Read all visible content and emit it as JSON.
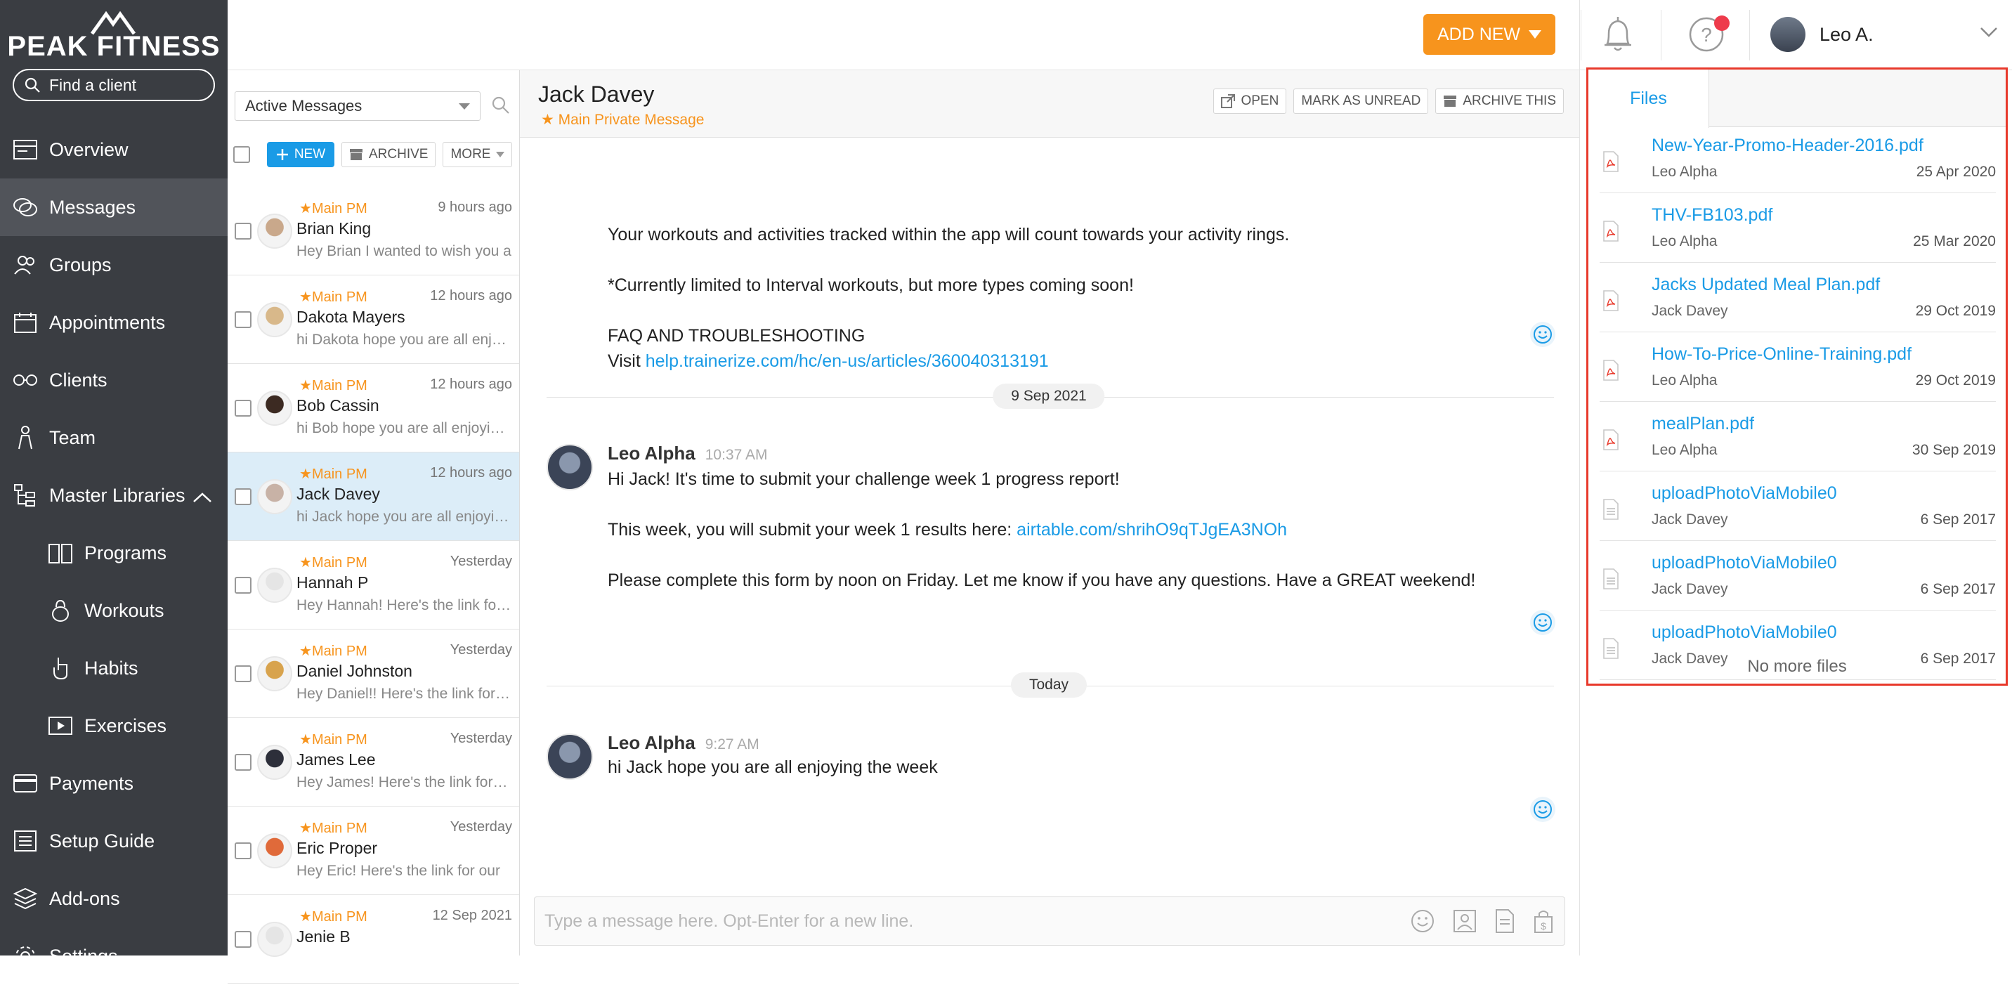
{
  "brand": {
    "name": "PEAK FITNESS"
  },
  "sidebar": {
    "search_label": "Find a client",
    "items": [
      {
        "label": "Overview",
        "icon": "overview-icon"
      },
      {
        "label": "Messages",
        "icon": "messages-icon",
        "active": true
      },
      {
        "label": "Groups",
        "icon": "groups-icon"
      },
      {
        "label": "Appointments",
        "icon": "calendar-icon"
      },
      {
        "label": "Clients",
        "icon": "clients-icon"
      },
      {
        "label": "Team",
        "icon": "team-icon"
      },
      {
        "label": "Master Libraries",
        "icon": "libraries-icon",
        "expanded": true
      },
      {
        "label": "Programs",
        "icon": "programs-icon",
        "sub": true
      },
      {
        "label": "Workouts",
        "icon": "kettlebell-icon",
        "sub": true
      },
      {
        "label": "Habits",
        "icon": "habits-icon",
        "sub": true
      },
      {
        "label": "Exercises",
        "icon": "video-icon",
        "sub": true
      },
      {
        "label": "Payments",
        "icon": "payments-icon"
      },
      {
        "label": "Setup Guide",
        "icon": "setup-guide-icon"
      },
      {
        "label": "Add-ons",
        "icon": "addons-icon"
      },
      {
        "label": "Settings",
        "icon": "settings-icon"
      }
    ]
  },
  "header": {
    "add_new_label": "ADD NEW",
    "user_name": "Leo A."
  },
  "conversations": {
    "filter_value": "Active Messages",
    "new_label": "NEW",
    "archive_label": "ARCHIVE",
    "more_label": "MORE",
    "items": [
      {
        "tag": "Main PM",
        "time": "9 hours ago",
        "name": "Brian King",
        "preview": "Hey Brian I wanted to wish you a",
        "avatar_color": "#c9a88b"
      },
      {
        "tag": "Main PM",
        "time": "12 hours ago",
        "name": "Dakota Mayers",
        "preview": "hi Dakota hope you are all enjoying the week",
        "avatar_color": "#d8b88a"
      },
      {
        "tag": "Main PM",
        "time": "12 hours ago",
        "name": "Bob Cassin",
        "preview": "hi Bob hope you are all enjoying the week",
        "avatar_color": "#3c2a22"
      },
      {
        "tag": "Main PM",
        "time": "12 hours ago",
        "name": "Jack Davey",
        "preview": "hi Jack hope you are all enjoying the week",
        "avatar_color": "#c8b2a6",
        "selected": true
      },
      {
        "tag": "Main PM",
        "time": "Yesterday",
        "name": "Hannah P",
        "preview": "Hey Hannah! Here's the link for our",
        "avatar_color": "#e5e5e5"
      },
      {
        "tag": "Main PM",
        "time": "Yesterday",
        "name": "Daniel Johnston",
        "preview": "Hey Daniel!! Here's the link for our",
        "avatar_color": "#d8a34d"
      },
      {
        "tag": "Main PM",
        "time": "Yesterday",
        "name": "James Lee",
        "preview": "Hey James! Here's the link for our",
        "avatar_color": "#2d2f3a"
      },
      {
        "tag": "Main PM",
        "time": "Yesterday",
        "name": "Eric Proper",
        "preview": "Hey Eric! Here's the link for our",
        "avatar_color": "#e06a3a"
      },
      {
        "tag": "Main PM",
        "time": "12 Sep 2021",
        "name": "Jenie B",
        "preview": "",
        "avatar_color": "#e5e5e5"
      }
    ]
  },
  "chat": {
    "contact_name": "Jack Davey",
    "thread_label": "Main Private Message",
    "open_label": "OPEN",
    "mark_unread_label": "MARK AS UNREAD",
    "archive_label": "ARCHIVE THIS",
    "top_lines": {
      "line1": "Your workouts and activities tracked within the app will count towards your activity rings.",
      "line2": "*Currently limited to Interval workouts, but more types coming soon!",
      "line3": "FAQ AND TROUBLESHOOTING",
      "visit_prefix": "Visit ",
      "visit_link": "help.trainerize.com/hc/en-us/articles/360040313191"
    },
    "date1": "9 Sep 2021",
    "msg1": {
      "sender": "Leo Alpha",
      "time": "10:37 AM",
      "line1": "Hi Jack! It's time to submit your challenge week 1 progress report!",
      "line2_prefix": "This week, you will submit your week 1 results here: ",
      "line2_link": "airtable.com/shrihO9qTJgEA3NOh",
      "line3": "Please complete this form by noon on Friday. Let me know if you have any questions. Have a GREAT weekend!"
    },
    "date2": "Today",
    "msg2": {
      "sender": "Leo Alpha",
      "time": "9:27 AM",
      "line1": "hi Jack hope you are all enjoying the week"
    },
    "composer_placeholder": "Type a message here. Opt-Enter for a new line."
  },
  "files": {
    "tab_label": "Files",
    "items": [
      {
        "name": "New-Year-Promo-Header-2016.pdf",
        "owner": "Leo Alpha",
        "date": "25 Apr 2020",
        "type": "pdf"
      },
      {
        "name": "THV-FB103.pdf",
        "owner": "Leo Alpha",
        "date": "25 Mar 2020",
        "type": "pdf"
      },
      {
        "name": "Jacks Updated Meal Plan.pdf",
        "owner": "Jack Davey",
        "date": "29 Oct 2019",
        "type": "pdf"
      },
      {
        "name": "How-To-Price-Online-Training.pdf",
        "owner": "Leo Alpha",
        "date": "29 Oct 2019",
        "type": "pdf"
      },
      {
        "name": "mealPlan.pdf",
        "owner": "Leo Alpha",
        "date": "30 Sep 2019",
        "type": "pdf"
      },
      {
        "name": "uploadPhotoViaMobile0",
        "owner": "Jack Davey",
        "date": "6 Sep 2017",
        "type": "doc"
      },
      {
        "name": "uploadPhotoViaMobile0",
        "owner": "Jack Davey",
        "date": "6 Sep 2017",
        "type": "doc"
      },
      {
        "name": "uploadPhotoViaMobile0",
        "owner": "Jack Davey",
        "date": "6 Sep 2017",
        "type": "doc"
      }
    ],
    "no_more_label": "No more files"
  },
  "colors": {
    "accent_orange": "#f7941d",
    "accent_blue": "#1a9be6",
    "sidebar_bg": "#3a3d42",
    "highlight_red": "#e8392b"
  }
}
